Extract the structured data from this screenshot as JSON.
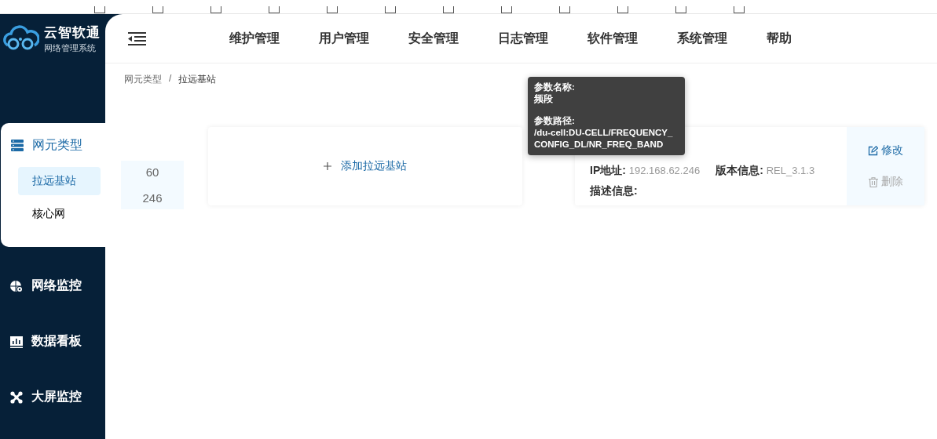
{
  "sidebar": {
    "logo": {
      "title": "云智软通",
      "subtitle": "网络管理系统"
    },
    "menu": [
      {
        "label": "网元类型",
        "kind": "server",
        "expanded": true,
        "children": [
          {
            "label": "拉远基站",
            "selected": true
          },
          {
            "label": "核心网",
            "selected": false
          }
        ]
      },
      {
        "label": "网络监控",
        "kind": "globe",
        "expanded": false
      },
      {
        "label": "数据看板",
        "kind": "chart",
        "expanded": false
      },
      {
        "label": "大屏监控",
        "kind": "nodes",
        "expanded": false
      }
    ]
  },
  "header": {
    "nav": [
      "维护管理",
      "用户管理",
      "安全管理",
      "日志管理",
      "软件管理",
      "系统管理",
      "帮助"
    ]
  },
  "breadcrumb": {
    "items": [
      "网元类型",
      "拉远基站"
    ],
    "separator": "/"
  },
  "id_column": [
    "60",
    "246"
  ],
  "add_card": {
    "label": "添加拉远基站"
  },
  "device_card": {
    "fields": [
      {
        "label": "IP地址:",
        "value": "192.168.62.246"
      },
      {
        "label": "版本信息:",
        "value": "REL_3.1.3"
      },
      {
        "label": "描述信息:"
      }
    ],
    "actions": [
      {
        "label": "修改",
        "kind": "edit",
        "disabled": false
      },
      {
        "label": "删除",
        "kind": "delete",
        "disabled": true
      }
    ]
  },
  "tooltip": {
    "sections": [
      {
        "label": "参数名称:",
        "value": "频段"
      },
      {
        "label": "参数路径:",
        "value": "/du-cell:DU-CELL/FREQUENCY_CONFIG_DL/NR_FREQ_BAND"
      }
    ]
  }
}
